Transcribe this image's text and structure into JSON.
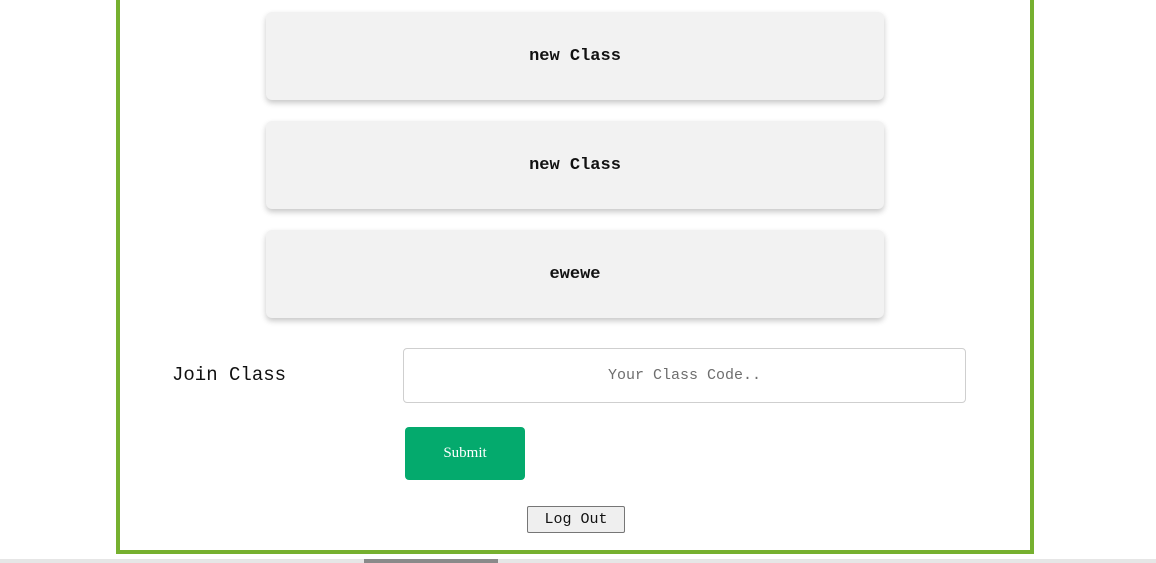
{
  "classes": [
    {
      "name": "new Class"
    },
    {
      "name": "new Class"
    },
    {
      "name": "ewewe"
    }
  ],
  "join": {
    "label": "Join Class",
    "input_value": "",
    "input_placeholder": "Your Class Code..",
    "submit_label": "Submit"
  },
  "logout_label": "Log Out",
  "colors": {
    "frame_border": "#76b02f",
    "submit_bg": "#04aa6d",
    "card_bg": "#f2f2f2"
  }
}
